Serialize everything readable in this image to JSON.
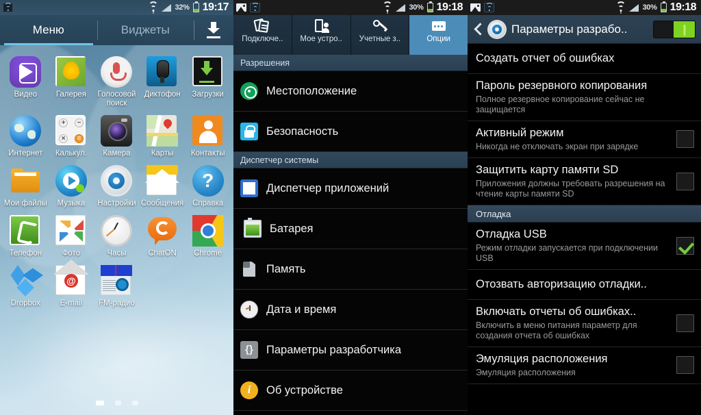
{
  "home": {
    "statusbar": {
      "battery_percent": "32%",
      "time": "19:17",
      "icons": [
        "wifi-tether-icon",
        "wifi-icon",
        "signal-icon",
        "battery-icon"
      ]
    },
    "tabs": [
      {
        "label": "Меню",
        "active": true
      },
      {
        "label": "Виджеты",
        "active": false
      }
    ],
    "download_icon": "download-icon",
    "apps": [
      {
        "label": "Видео",
        "icon": "video-app-icon"
      },
      {
        "label": "Галерея",
        "icon": "gallery-app-icon"
      },
      {
        "label": "Голосовой поиск",
        "icon": "voice-search-app-icon"
      },
      {
        "label": "Диктофон",
        "icon": "voice-recorder-app-icon"
      },
      {
        "label": "Загрузки",
        "icon": "downloads-app-icon"
      },
      {
        "label": "Интернет",
        "icon": "internet-app-icon"
      },
      {
        "label": "Калькул.",
        "icon": "calculator-app-icon"
      },
      {
        "label": "Камера",
        "icon": "camera-app-icon"
      },
      {
        "label": "Карты",
        "icon": "maps-app-icon"
      },
      {
        "label": "Контакты",
        "icon": "contacts-app-icon"
      },
      {
        "label": "Мои файлы",
        "icon": "my-files-app-icon"
      },
      {
        "label": "Музыка",
        "icon": "music-app-icon"
      },
      {
        "label": "Настройки",
        "icon": "settings-app-icon"
      },
      {
        "label": "Сообщения",
        "icon": "messages-app-icon"
      },
      {
        "label": "Справка",
        "icon": "help-app-icon"
      },
      {
        "label": "Телефон",
        "icon": "phone-app-icon"
      },
      {
        "label": "Фото",
        "icon": "photos-app-icon"
      },
      {
        "label": "Часы",
        "icon": "clock-app-icon"
      },
      {
        "label": "ChatON",
        "icon": "chaton-app-icon"
      },
      {
        "label": "Chrome",
        "icon": "chrome-app-icon"
      },
      {
        "label": "Dropbox",
        "icon": "dropbox-app-icon"
      },
      {
        "label": "E-mail",
        "icon": "email-app-icon"
      },
      {
        "label": "FM-радио",
        "icon": "fm-radio-app-icon"
      }
    ],
    "pages": {
      "count": 3,
      "current": 1
    }
  },
  "settings": {
    "statusbar": {
      "battery_percent": "30%",
      "time": "19:18",
      "icons": [
        "gallery-icon",
        "wifi-icon",
        "wifi-tether-icon",
        "signal-icon",
        "battery-icon"
      ]
    },
    "tabs": [
      {
        "label": "Подключе..",
        "icon": "connections-tab-icon",
        "active": false
      },
      {
        "label": "Мое устро..",
        "icon": "my-device-tab-icon",
        "active": false
      },
      {
        "label": "Учетные з..",
        "icon": "accounts-tab-icon",
        "active": false
      },
      {
        "label": "Опции",
        "icon": "more-options-tab-icon",
        "active": true
      }
    ],
    "sections": [
      {
        "header": "Разрешения",
        "rows": [
          {
            "label": "Местоположение",
            "icon": "location-icon"
          },
          {
            "label": "Безопасность",
            "icon": "security-lock-icon"
          }
        ]
      },
      {
        "header": "Диспетчер системы",
        "rows": [
          {
            "label": "Диспетчер приложений",
            "icon": "application-manager-icon"
          },
          {
            "label": "Батарея",
            "icon": "battery-icon"
          },
          {
            "label": "Память",
            "icon": "storage-sdcard-icon"
          },
          {
            "label": "Дата и время",
            "icon": "date-time-clock-icon"
          },
          {
            "label": "Параметры разработчика",
            "icon": "developer-braces-icon"
          },
          {
            "label": "Об устройстве",
            "icon": "about-device-info-icon"
          }
        ]
      }
    ]
  },
  "developer": {
    "statusbar": {
      "battery_percent": "30%",
      "time": "19:18",
      "icons": [
        "gallery-icon",
        "wifi-icon",
        "wifi-tether-icon",
        "signal-icon",
        "battery-icon"
      ]
    },
    "header": {
      "back_icon": "back-chevron-icon",
      "gear_icon": "settings-gear-icon",
      "title": "Параметры разрабо..",
      "toggle_on": true
    },
    "rows": [
      {
        "title": "Создать отчет об ошибках",
        "subtitle": "",
        "checkbox": null
      },
      {
        "title": "Пароль резервного копирования",
        "subtitle": "Полное резервное копирование сейчас не защищается",
        "checkbox": null
      },
      {
        "title": "Активный режим",
        "subtitle": "Никогда не отключать экран при зарядке",
        "checkbox": false
      },
      {
        "title": "Защитить карту памяти SD",
        "subtitle": "Приложения должны требовать разрешения на чтение карты памяти SD",
        "checkbox": false
      },
      {
        "section_header": "Отладка"
      },
      {
        "title": "Отладка USB",
        "subtitle": "Режим отладки запускается при подключении USB",
        "checkbox": true
      },
      {
        "title": "Отозвать авторизацию отладки..",
        "subtitle": "",
        "checkbox": null
      },
      {
        "title": "Включать отчеты об ошибках..",
        "subtitle": "Включить в меню питания параметр для создания отчета об ошибках",
        "checkbox": false
      },
      {
        "title": "Эмуляция расположения",
        "subtitle": "Эмуляция расположения",
        "checkbox": false
      }
    ]
  },
  "colors": {
    "accent_blue": "#4c8cb8",
    "toggle_green": "#7ed321",
    "check_green": "#6fd038",
    "section_header_bg": "#32495c",
    "dark_bg": "#000000"
  }
}
